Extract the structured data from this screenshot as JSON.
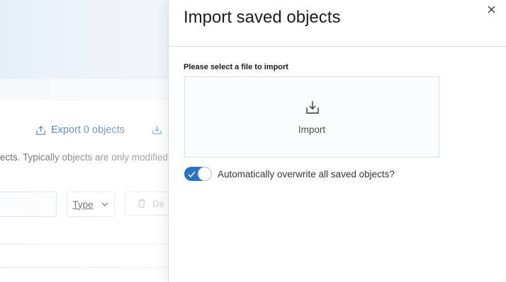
{
  "background": {
    "export_label": "Export 0 objects",
    "description": "ects. Typically objects are only modified",
    "type_filter_label": "Type",
    "delete_label": "De"
  },
  "flyout": {
    "title": "Import saved objects",
    "file_label": "Please select a file to import",
    "file_prompt": "Import",
    "overwrite_label": "Automatically overwrite all saved objects?",
    "overwrite_enabled": true
  },
  "colors": {
    "accent": "#2873c7",
    "link": "#2566b5",
    "header_bg": "#e5eef8"
  },
  "icons": {
    "close": "close-icon",
    "upload": "import-icon",
    "export": "export-icon",
    "download": "download-icon",
    "chevron": "chevron-down-icon",
    "trash": "trash-icon",
    "check": "check-icon"
  }
}
